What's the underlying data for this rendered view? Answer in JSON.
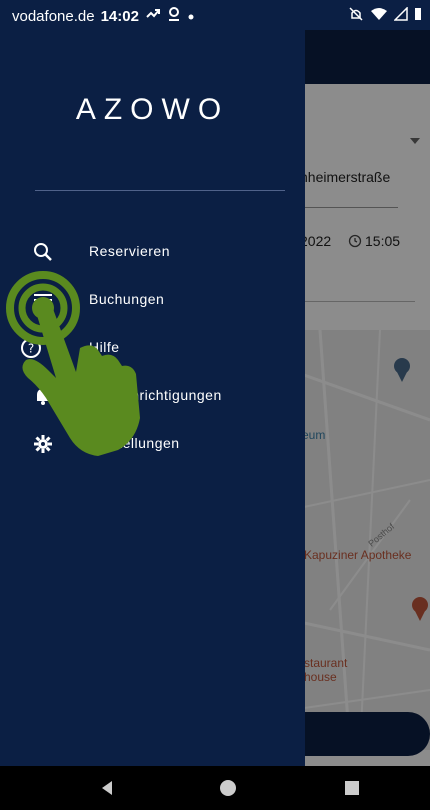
{
  "status_bar": {
    "carrier": "vodafone.de",
    "time": "14:02"
  },
  "drawer": {
    "logo": "AZOWO",
    "menu": [
      {
        "label": "Reservieren",
        "icon": "search-icon"
      },
      {
        "label": "Buchungen",
        "icon": "list-icon"
      },
      {
        "label": "Hilfe",
        "icon": "help-icon"
      },
      {
        "label": "Benachrichtigungen",
        "icon": "bell-icon"
      },
      {
        "label": "Einstellungen",
        "icon": "gear-icon"
      }
    ]
  },
  "background_app": {
    "street": "nheimerstraße",
    "date": "2022",
    "time": "15:05",
    "map_labels": {
      "museum": "eum",
      "posthof": "Posthof",
      "apotheke": "Kapuziner Apotheke",
      "restaurant_line1": "staurant",
      "restaurant_line2": "house"
    }
  },
  "gesture": {
    "type": "tap",
    "target": "Buchungen"
  },
  "colors": {
    "drawer": "#0b1f44",
    "gesture": "#5a8a1f"
  }
}
